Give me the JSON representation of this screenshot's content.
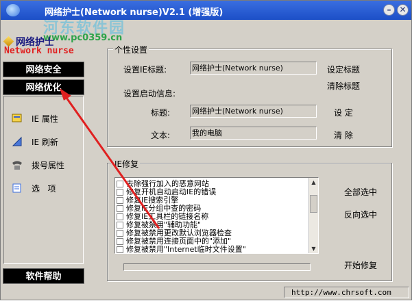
{
  "window": {
    "title": "网络护士(Network nurse)V2.1 (增强版)",
    "buttons": {
      "minimize": "–",
      "close": "✕"
    }
  },
  "watermark": {
    "site": "河东软件园",
    "url": "www.pc0359.cn"
  },
  "logo": {
    "cn": "网络护士",
    "en": "Network nurse"
  },
  "sidebar": {
    "nav": [
      {
        "label": "网络安全",
        "active": false
      },
      {
        "label": "网络优化",
        "active": true
      }
    ],
    "items": [
      {
        "icon": "ie-properties-icon",
        "label": "IE 属性"
      },
      {
        "icon": "ie-refresh-icon",
        "label": "IE 刷新"
      },
      {
        "icon": "dialup-icon",
        "label": "拨号属性"
      },
      {
        "icon": "options-icon",
        "label": "选   项"
      }
    ],
    "help": "软件帮助"
  },
  "personal": {
    "group_title": "个性设置",
    "ie_title_label": "设置IE标题:",
    "ie_title_value": "网络护士(Network nurse)",
    "set_title": "设定标题",
    "clear_title": "清除标题",
    "startup_label": "设置启动信息:",
    "caption_label": "标题:",
    "caption_value": "网络护士(Network nurse)",
    "text_label": "文本:",
    "text_value": "我的电脑",
    "apply": "设 定",
    "clear": "清 除"
  },
  "ie_repair": {
    "group_title": "IE修复",
    "items": [
      "去除强行加入的恶意网站",
      "修复开机自动启动IE的错误",
      "修复IE搜索引擎",
      "修复IE分组中查的密码",
      "修复IE工具栏的链接名称",
      "修复被禁用\"辅助功能\"",
      "修复被禁用更改默认浏览器检查",
      "修复被禁用连接页面中的\"添加\"",
      "修复被禁用\"Internet临时文件设置\""
    ],
    "select_all": "全部选中",
    "invert": "反向选中",
    "start": "开始修复",
    "progress": 0
  },
  "status": {
    "url": "http://www.chrsoft.com"
  },
  "colors": {
    "titlebar": "#1c4fc7",
    "nav_bg": "#000000",
    "logo_en": "#e02020",
    "arrow": "#e02020"
  }
}
